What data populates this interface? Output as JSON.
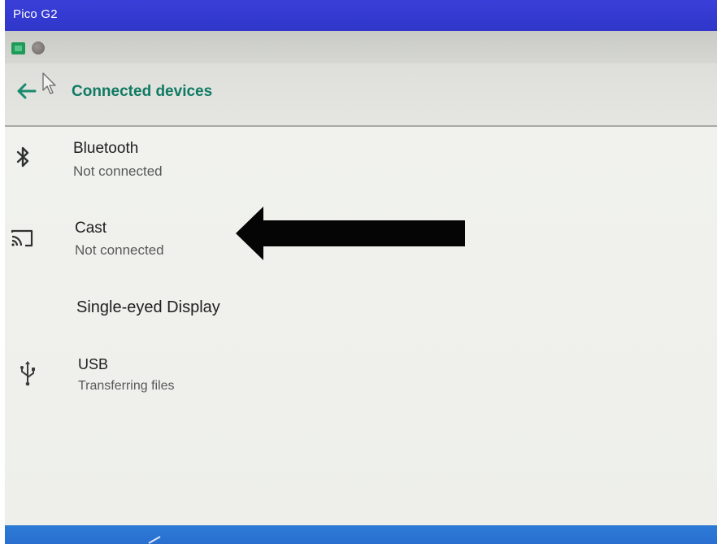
{
  "window": {
    "title": "Pico G2"
  },
  "statusbar": {
    "icons": [
      "app-icon",
      "notification-dot-icon"
    ]
  },
  "appbar": {
    "back_icon": "arrow-left-icon",
    "title": "Connected devices"
  },
  "items": [
    {
      "title": "Bluetooth",
      "subtitle": "Not connected",
      "icon": "bluetooth-icon"
    },
    {
      "title": "Cast",
      "subtitle": "Not connected",
      "icon": "cast-icon"
    },
    {
      "title": "Single-eyed Display",
      "subtitle": "",
      "icon": ""
    },
    {
      "title": "USB",
      "subtitle": "Transferring files",
      "icon": "usb-icon"
    }
  ],
  "annotation": {
    "arrow": "black-left-arrow",
    "points_to": "Cast"
  },
  "colors": {
    "titlebar": "#2f36c9",
    "accent_title": "#0f7a62",
    "bottom_nav": "#2a6fd0"
  }
}
